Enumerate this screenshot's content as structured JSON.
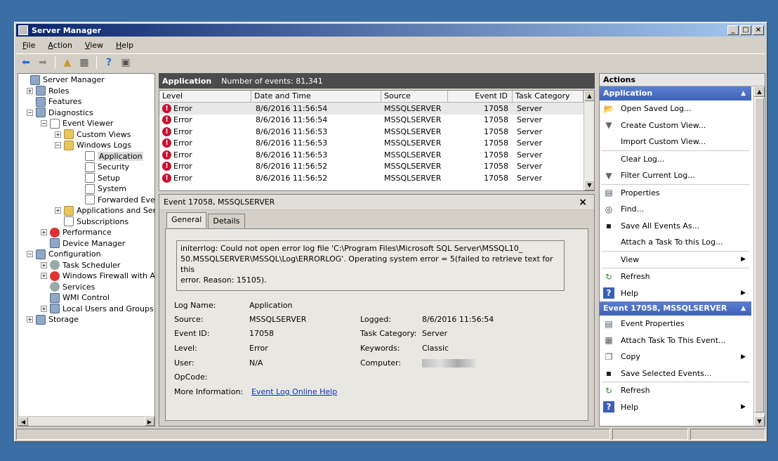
{
  "window": {
    "title": "Server Manager"
  },
  "menu": [
    "File",
    "Action",
    "View",
    "Help"
  ],
  "tree": {
    "items": [
      {
        "label": "Server Manager",
        "level": 0,
        "expander": "",
        "icon": "comp"
      },
      {
        "label": "Roles",
        "level": 1,
        "expander": "+",
        "icon": "comp"
      },
      {
        "label": "Features",
        "level": 1,
        "expander": "",
        "icon": "comp"
      },
      {
        "label": "Diagnostics",
        "level": 1,
        "expander": "−",
        "icon": "comp"
      },
      {
        "label": "Event Viewer",
        "level": 2,
        "expander": "−",
        "icon": "log"
      },
      {
        "label": "Custom Views",
        "level": 3,
        "expander": "+",
        "icon": "folder"
      },
      {
        "label": "Windows Logs",
        "level": 3,
        "expander": "−",
        "icon": "folder"
      },
      {
        "label": "Application",
        "level": 4,
        "expander": "",
        "icon": "log",
        "selected": true
      },
      {
        "label": "Security",
        "level": 4,
        "expander": "",
        "icon": "log"
      },
      {
        "label": "Setup",
        "level": 4,
        "expander": "",
        "icon": "log"
      },
      {
        "label": "System",
        "level": 4,
        "expander": "",
        "icon": "log"
      },
      {
        "label": "Forwarded Events",
        "level": 4,
        "expander": "",
        "icon": "log"
      },
      {
        "label": "Applications and Servic",
        "level": 3,
        "expander": "+",
        "icon": "folder"
      },
      {
        "label": "Subscriptions",
        "level": 3,
        "expander": "",
        "icon": "log"
      },
      {
        "label": "Performance",
        "level": 2,
        "expander": "+",
        "icon": "red"
      },
      {
        "label": "Device Manager",
        "level": 2,
        "expander": "",
        "icon": "comp"
      },
      {
        "label": "Configuration",
        "level": 1,
        "expander": "−",
        "icon": "comp"
      },
      {
        "label": "Task Scheduler",
        "level": 2,
        "expander": "+",
        "icon": "gear"
      },
      {
        "label": "Windows Firewall with Adva",
        "level": 2,
        "expander": "+",
        "icon": "red"
      },
      {
        "label": "Services",
        "level": 2,
        "expander": "",
        "icon": "gear"
      },
      {
        "label": "WMI Control",
        "level": 2,
        "expander": "",
        "icon": "comp"
      },
      {
        "label": "Local Users and Groups",
        "level": 2,
        "expander": "+",
        "icon": "comp"
      },
      {
        "label": "Storage",
        "level": 1,
        "expander": "+",
        "icon": "comp"
      }
    ]
  },
  "log": {
    "name": "Application",
    "count_label": "Number of events: 81,341",
    "columns": [
      "Level",
      "Date and Time",
      "Source",
      "Event ID",
      "Task Category"
    ],
    "rows": [
      {
        "level": "Error",
        "date": "8/6/2016 11:56:54",
        "source": "MSSQLSERVER",
        "id": "17058",
        "cat": "Server"
      },
      {
        "level": "Error",
        "date": "8/6/2016 11:56:54",
        "source": "MSSQLSERVER",
        "id": "17058",
        "cat": "Server"
      },
      {
        "level": "Error",
        "date": "8/6/2016 11:56:53",
        "source": "MSSQLSERVER",
        "id": "17058",
        "cat": "Server"
      },
      {
        "level": "Error",
        "date": "8/6/2016 11:56:53",
        "source": "MSSQLSERVER",
        "id": "17058",
        "cat": "Server"
      },
      {
        "level": "Error",
        "date": "8/6/2016 11:56:53",
        "source": "MSSQLSERVER",
        "id": "17058",
        "cat": "Server"
      },
      {
        "level": "Error",
        "date": "8/6/2016 11:56:52",
        "source": "MSSQLSERVER",
        "id": "17058",
        "cat": "Server"
      },
      {
        "level": "Error",
        "date": "8/6/2016 11:56:52",
        "source": "MSSQLSERVER",
        "id": "17058",
        "cat": "Server"
      }
    ]
  },
  "detail": {
    "title": "Event 17058, MSSQLSERVER",
    "tabs": [
      "General",
      "Details"
    ],
    "message_lines": [
      "initerrlog: Could not open error log file 'C:\\Program Files\\Microsoft SQL Server\\MSSQL10_",
      "50.MSSQLSERVER\\MSSQL\\Log\\ERRORLOG'. Operating system error = 5(failed to retrieve text for this",
      "error. Reason: 15105)."
    ],
    "log_name_label": "Log Name:",
    "log_name": "Application",
    "source_label": "Source:",
    "source": "MSSQLSERVER",
    "logged_label": "Logged:",
    "logged": "8/6/2016 11:56:54",
    "event_id_label": "Event ID:",
    "event_id": "17058",
    "task_label": "Task Category:",
    "task": "Server",
    "level_label": "Level:",
    "level": "Error",
    "keywords_label": "Keywords:",
    "keywords": "Classic",
    "user_label": "User:",
    "user": "N/A",
    "computer_label": "Computer:",
    "opcode_label": "OpCode:",
    "more_label": "More Information:",
    "more_link": "Event Log Online Help"
  },
  "actions": {
    "header": "Actions",
    "sections": [
      {
        "title": "Application",
        "items": [
          {
            "label": "Open Saved Log...",
            "icon": "open-folder-icon"
          },
          {
            "label": "Create Custom View...",
            "icon": "filter-icon"
          },
          {
            "label": "Import Custom View...",
            "icon": ""
          },
          {
            "sep": true
          },
          {
            "label": "Clear Log...",
            "icon": ""
          },
          {
            "label": "Filter Current Log...",
            "icon": "filter-icon"
          },
          {
            "sep": true
          },
          {
            "label": "Properties",
            "icon": "properties-icon"
          },
          {
            "label": "Find...",
            "icon": "binoculars-icon"
          },
          {
            "label": "Save All Events As...",
            "icon": "save-icon"
          },
          {
            "label": "Attach a Task To this Log...",
            "icon": ""
          },
          {
            "sep": true
          },
          {
            "label": "View",
            "icon": "",
            "sub": true
          },
          {
            "sep": true
          },
          {
            "label": "Refresh",
            "icon": "refresh-icon"
          },
          {
            "label": "Help",
            "icon": "help-icon",
            "sub": true
          }
        ]
      },
      {
        "title": "Event 17058, MSSQLSERVER",
        "items": [
          {
            "label": "Event Properties",
            "icon": "properties-icon"
          },
          {
            "label": "Attach Task To This Event...",
            "icon": "task-icon"
          },
          {
            "label": "Copy",
            "icon": "copy-icon",
            "sub": true
          },
          {
            "label": "Save Selected Events...",
            "icon": "save-icon"
          },
          {
            "sep": true
          },
          {
            "label": "Refresh",
            "icon": "refresh-icon"
          },
          {
            "label": "Help",
            "icon": "help-icon",
            "sub": true
          }
        ]
      }
    ]
  }
}
